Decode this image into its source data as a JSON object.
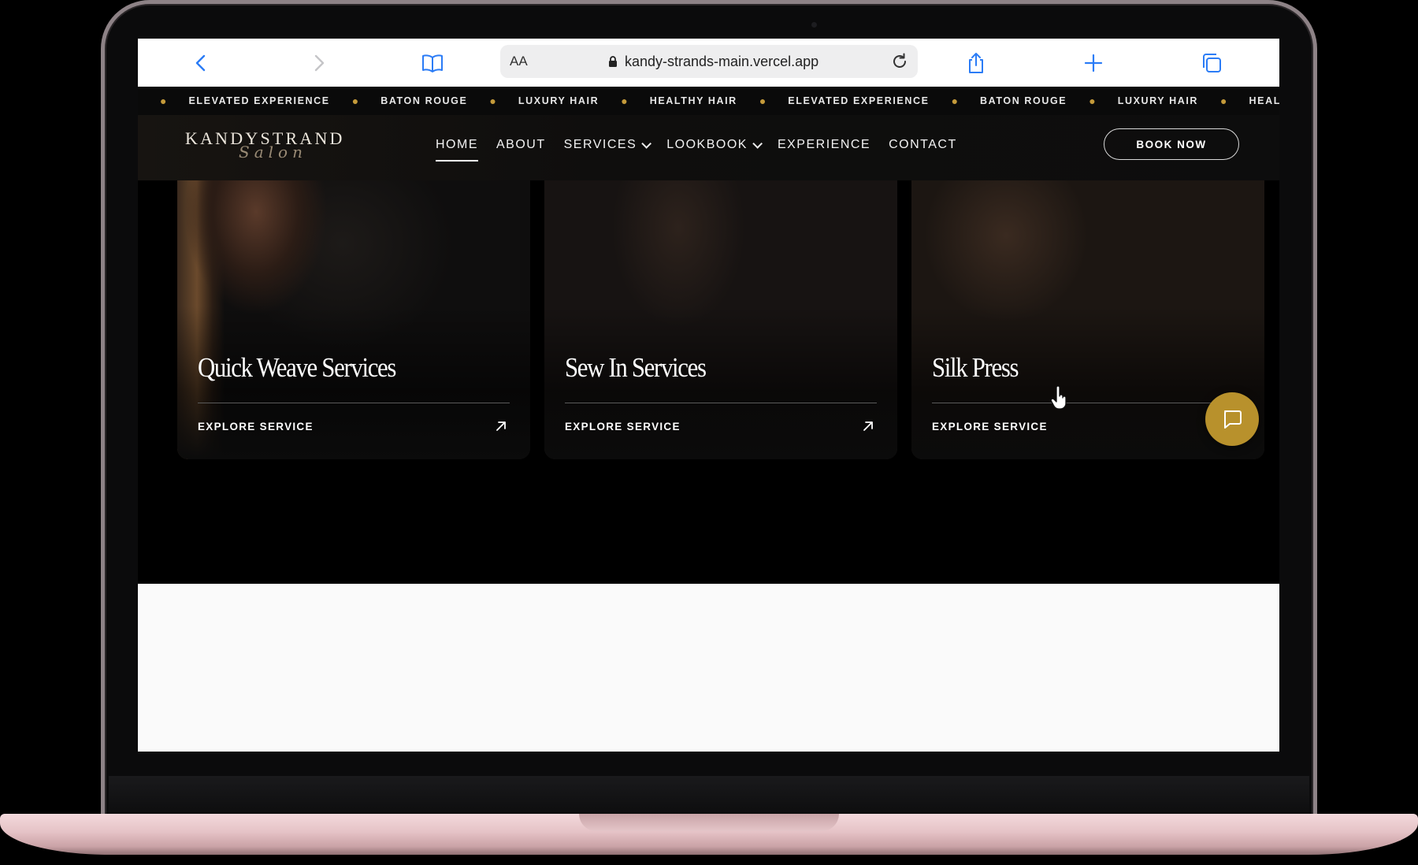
{
  "browser": {
    "reader_label": "AA",
    "url": "kandy-strands-main.vercel.app"
  },
  "marquee": {
    "items": [
      "ELEVATED EXPERIENCE",
      "BATON ROUGE",
      "LUXURY HAIR",
      "HEALTHY HAIR",
      "ELEVATED EXPERIENCE",
      "BATON ROUGE",
      "LUXURY HAIR",
      "HEALTHY HAI"
    ],
    "dot_color": "#c49a3a"
  },
  "nav": {
    "logo_main": "KANDYSTRAND",
    "logo_script": "Salon",
    "links": [
      {
        "label": "HOME",
        "active": true
      },
      {
        "label": "ABOUT"
      },
      {
        "label": "SERVICES",
        "dropdown": true
      },
      {
        "label": "LOOKBOOK",
        "dropdown": true
      },
      {
        "label": "EXPERIENCE"
      },
      {
        "label": "CONTACT"
      }
    ],
    "book_now": "BOOK NOW"
  },
  "services": [
    {
      "title": "Quick Weave Services",
      "cta": "EXPLORE SERVICE"
    },
    {
      "title": "Sew In Services",
      "cta": "EXPLORE SERVICE"
    },
    {
      "title": "Silk Press",
      "cta": "EXPLORE SERVICE"
    }
  ],
  "colors": {
    "accent_gold": "#b8912c",
    "background": "#000000",
    "laptop_rose": "#e5c2c6"
  },
  "icons": {
    "chat": "chat-bubble-icon",
    "card_arrow": "arrow-up-right-icon"
  }
}
